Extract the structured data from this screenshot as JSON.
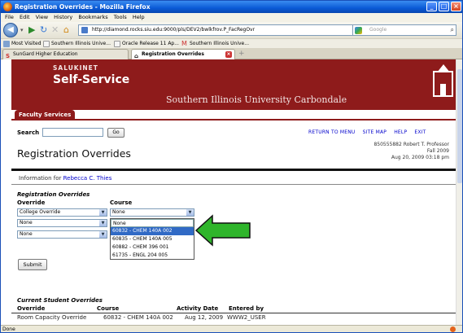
{
  "window": {
    "title": "Registration Overrides - Mozilla Firefox"
  },
  "menu": [
    "File",
    "Edit",
    "View",
    "History",
    "Bookmarks",
    "Tools",
    "Help"
  ],
  "nav": {
    "url": "http://diamond.rocks.siu.edu:9000/pls/DEV2/bwlkfrov.P_FacRegOvr",
    "search_placeholder": "Google"
  },
  "bookmarks": [
    "Most Visited",
    "Southern Illinois Unive...",
    "Oracle Release 11 Ap...",
    "Southern Illinois Unive..."
  ],
  "tabs": [
    "SunGard Higher Education",
    "Registration Overrides"
  ],
  "status": "Done",
  "banner": {
    "line1": "SALUKINET",
    "line2": "Self-Service",
    "university": "Southern Illinois University Carbondale"
  },
  "faculty_tab": "Faculty Services",
  "search": {
    "label": "Search",
    "go": "Go"
  },
  "links": [
    "RETURN TO MENU",
    "SITE MAP",
    "HELP",
    "EXIT"
  ],
  "page": {
    "title": "Registration Overrides",
    "user_line": "850555882 Robert T. Professor",
    "term": "Fall 2009",
    "date": "Aug 20, 2009 03:18 pm",
    "info_prefix": "Information for",
    "student": "Rebecca C. Thies"
  },
  "overrides": {
    "section_title": "Registration Overrides",
    "col_override": "Override",
    "col_course": "Course",
    "rows": [
      {
        "override": "College Override",
        "course": "None"
      },
      {
        "override": "None"
      },
      {
        "override": "None"
      }
    ],
    "dropdown": [
      "None",
      "60832 - CHEM 140A 002",
      "60835 - CHEM 140A 005",
      "60882 - CHEM 396 001",
      "61735 - ENGL 204 005"
    ],
    "submit": "Submit"
  },
  "current": {
    "title": "Current Student Overrides",
    "headers": [
      "Override",
      "Course",
      "Activity Date",
      "Entered by"
    ],
    "row": [
      "Room Capacity Override",
      "60832 - CHEM 140A 002",
      "Aug 12, 2009",
      "WWW2_USER"
    ]
  },
  "colors": {
    "maroon": "#8e1b1b",
    "highlight": "#316ac5",
    "arrow": "#2fb52b"
  }
}
